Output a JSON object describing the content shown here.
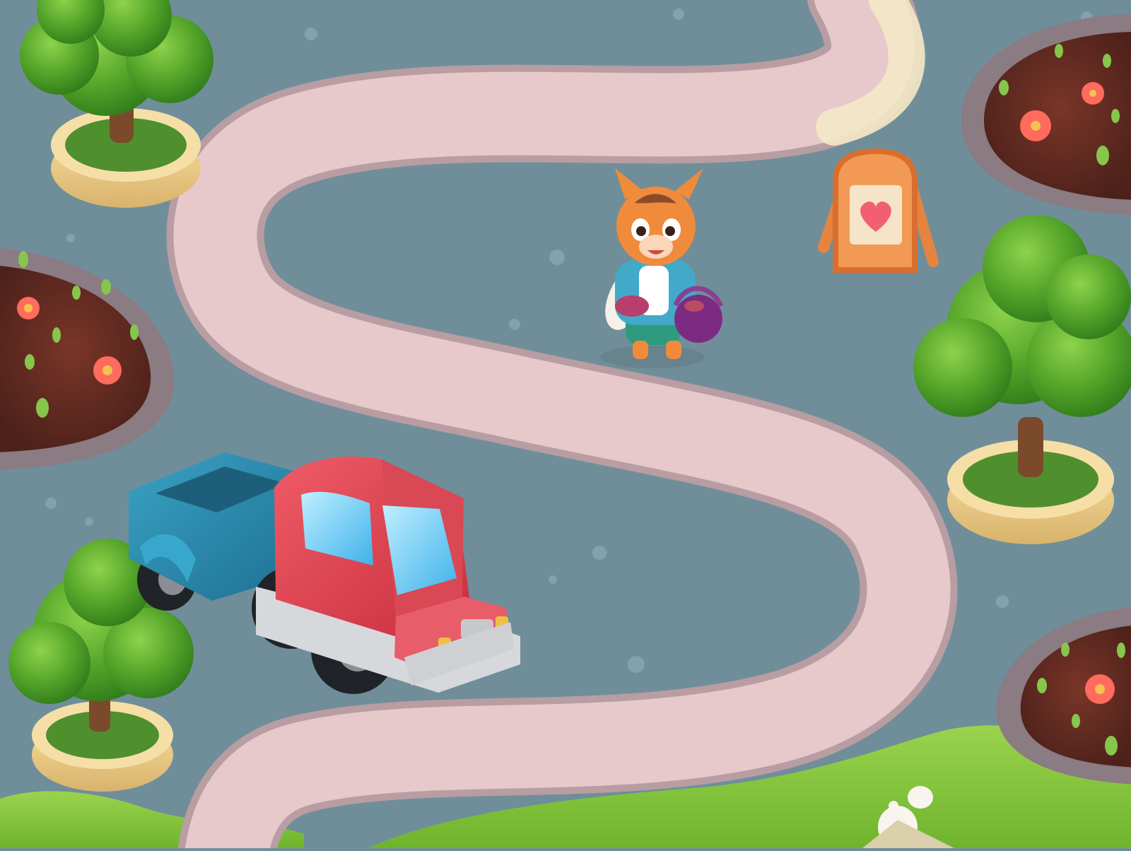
{
  "scene": {
    "type": "game-map",
    "background_color": "#6f8e9a",
    "path_color": "#e7c8cb",
    "grass_color": "#8cc63f",
    "soil_color": "#6b2f22",
    "border_color": "#8b7b83",
    "pot_color": "#f2d390",
    "icon_names": [
      "tree-icon",
      "flower-bed-icon",
      "flower-icon",
      "truck-icon",
      "trailer-icon",
      "character-icon",
      "sign-icon",
      "heart-icon"
    ]
  }
}
